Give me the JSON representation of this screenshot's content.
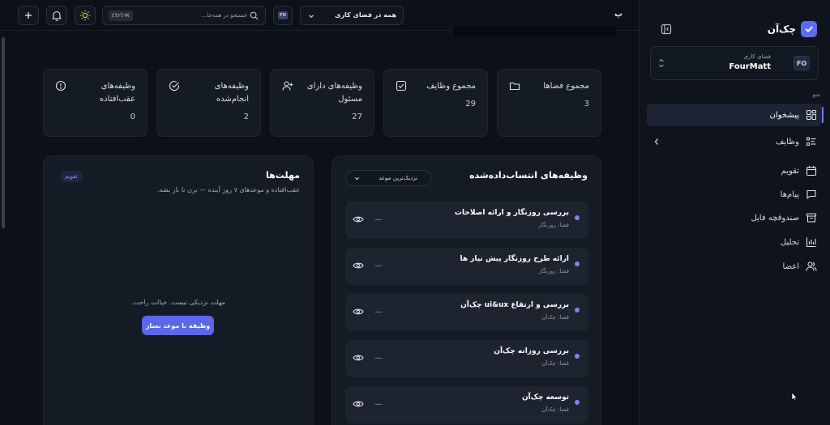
{
  "app": {
    "name": "چک‌آن"
  },
  "workspace": {
    "label": "فضای کاری",
    "name": "FourMatt",
    "initials": "FO"
  },
  "sidebar": {
    "menu_label": "منو",
    "items": [
      {
        "label": "پیشخوان",
        "icon": "dashboard-icon",
        "active": true
      },
      {
        "label": "وظایف",
        "icon": "tasks-icon",
        "expandable": true
      },
      {
        "label": "تقویم",
        "icon": "calendar-icon"
      },
      {
        "label": "پیام‌ها",
        "icon": "message-icon"
      },
      {
        "label": "صندوقچه فایل",
        "icon": "archive-icon"
      },
      {
        "label": "تحلیل",
        "icon": "analytics-icon"
      },
      {
        "label": "اعضا",
        "icon": "members-icon"
      }
    ]
  },
  "topbar": {
    "search_placeholder": "جستجو در همه‌جا...",
    "shortcut": "Ctrl+K",
    "workspace_filter": "همه در فضای کاری",
    "workspace_badge": "FO",
    "partial_text": "پ"
  },
  "stats": [
    {
      "label": "مجموع فضاها",
      "value": "3",
      "icon": "folder-icon"
    },
    {
      "label": "مجموع وظایف",
      "value": "29",
      "icon": "checkbox-icon"
    },
    {
      "label": "وظیفه‌های دارای مسئول",
      "value": "27",
      "icon": "user-plus-icon"
    },
    {
      "label": "وظیفه‌های انجام‌شده",
      "value": "2",
      "icon": "check-circle-icon"
    },
    {
      "label": "وظیفه‌های عقب‌افتاده",
      "value": "0",
      "icon": "alert-circle-icon"
    }
  ],
  "assigned": {
    "title": "وظیفه‌های انتساب‌داده‌شده",
    "sort_label": "نزدیک‌ترین موعد",
    "tasks": [
      {
        "title": "بررسی روزنگار و ارائه اصلاحات",
        "space": "فضا: روزنگار",
        "due": "—"
      },
      {
        "title": "ارائه طرح روزنگار پیش نیاز ها",
        "space": "فضا: روزنگار",
        "due": "—"
      },
      {
        "title": "بررسی و ارتقاع ui&ux چک‌آن",
        "space": "فضا: چک‌آن",
        "due": "—"
      },
      {
        "title": "بررسی روزانه چک‌آن",
        "space": "فضا: چک‌آن",
        "due": "—"
      },
      {
        "title": "توسعه چک‌آن",
        "space": "فضا: چک‌آن",
        "due": "—"
      }
    ]
  },
  "deadlines": {
    "title": "مهلت‌ها",
    "subtitle": "عقب‌افتاده و موعدهای ۷ روز آینده — بزن تا باز بشه.",
    "badge": "تقویم",
    "empty_text": "مهلت نزدیکی نیست. خیالت راحت.",
    "cta": "وظیفه با موعد بساز"
  },
  "colors": {
    "accent": "#5c66e8",
    "background": "#0c1017",
    "card": "#151b24"
  }
}
